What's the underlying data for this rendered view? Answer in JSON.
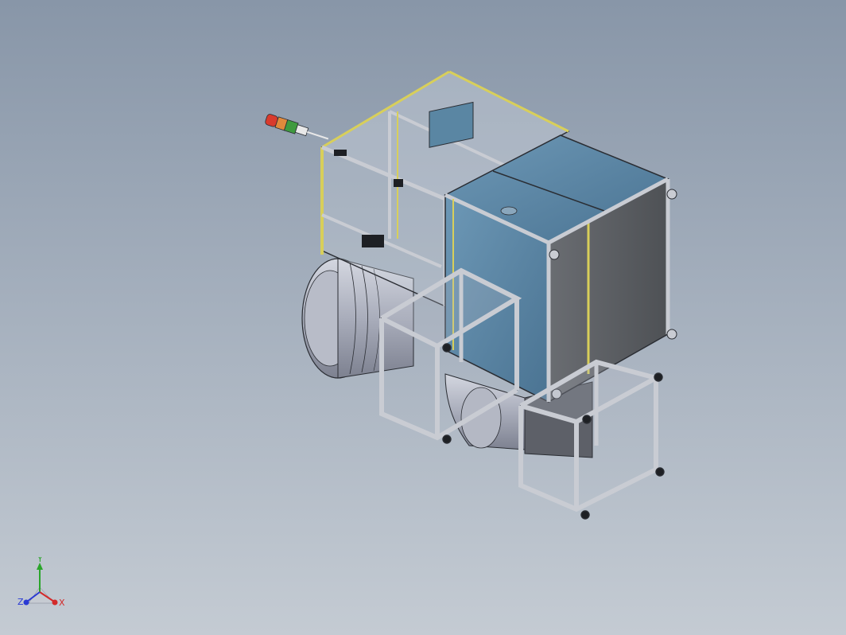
{
  "viewport": {
    "background_top": "#8896a8",
    "background_bottom": "#c4cbd3"
  },
  "model": {
    "frame_color": "#c9ccd3",
    "frame_edge": "#2a2d33",
    "accent_rail": "#d8cf5a",
    "panel_blue": "#5c88a6",
    "panel_dark": "#5b5e63",
    "duct_color": "#a9adbb",
    "glass": "#cfd6df",
    "signal_tower": [
      "#d93b2d",
      "#e08a3c",
      "#3f9a3f"
    ]
  },
  "triad": {
    "x_label": "X",
    "y_label": "Y",
    "z_label": "Z",
    "x_color": "#d32a2a",
    "y_color": "#2aa52a",
    "z_color": "#2a3ad3"
  }
}
